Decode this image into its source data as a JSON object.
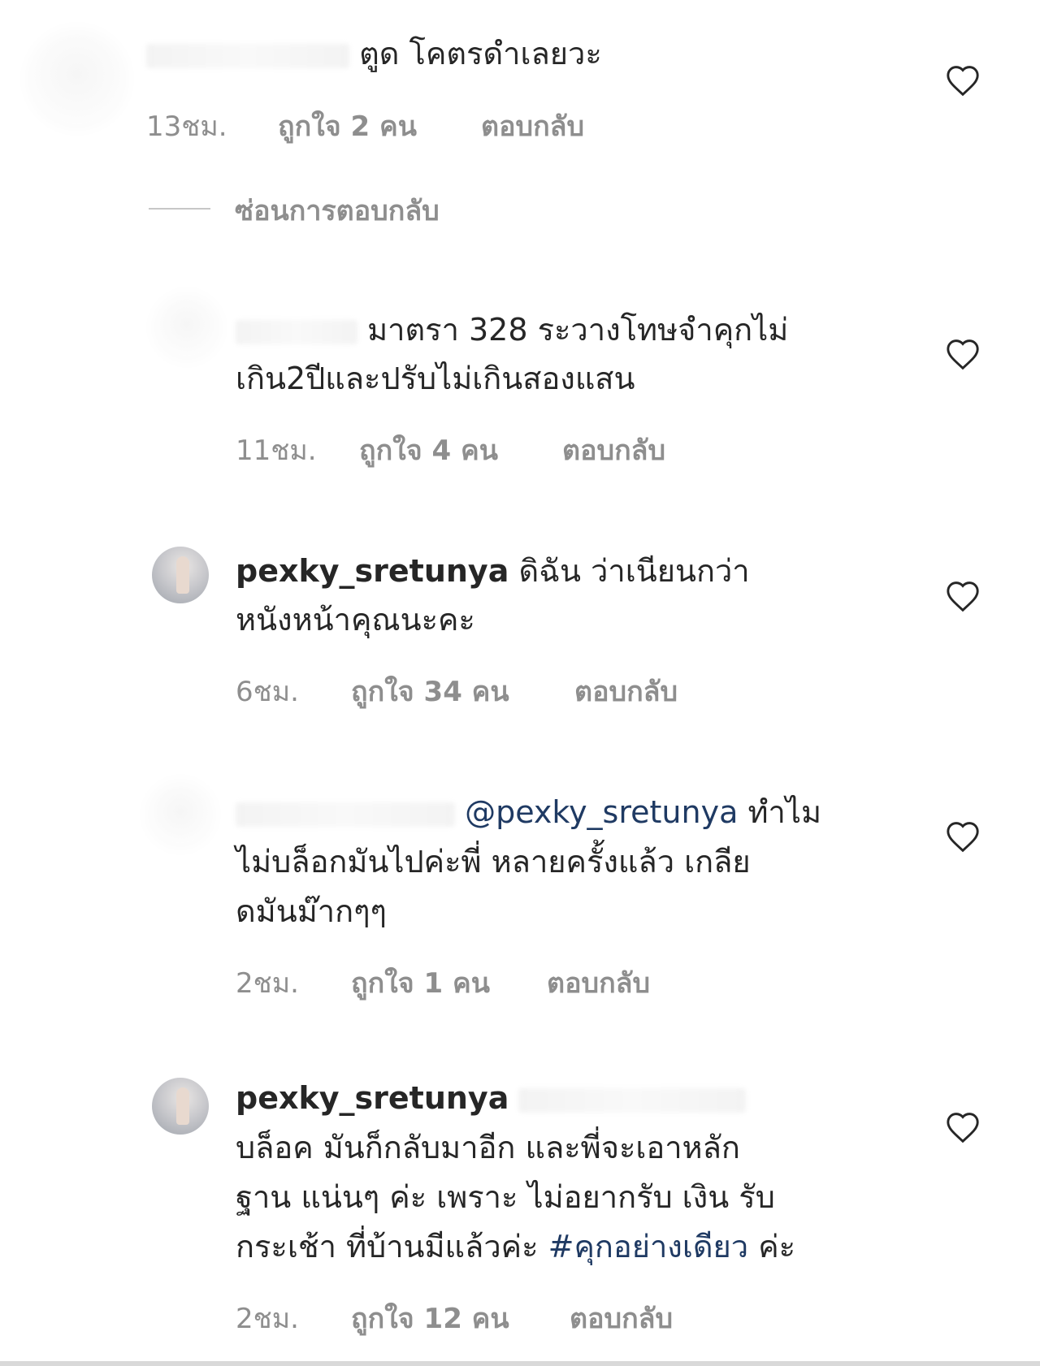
{
  "comments": [
    {
      "text": "ตูด โคตรดำเลยวะ",
      "time": "13ชม.",
      "likes": "ถูกใจ 2 คน",
      "reply": "ตอบกลับ"
    },
    {
      "text_line1": "มาตรา 328 ระวางโทษจำคุกไม่",
      "text_line2": "เกิน2ปีและปรับไม่เกินสองแสน",
      "time": "11ชม.",
      "likes": "ถูกใจ 4 คน",
      "reply": "ตอบกลับ"
    },
    {
      "username": "pexky_sretunya",
      "text_line1": "ดิฉัน ว่าเนียนกว่า",
      "text_line2": "หนังหน้าคุณนะคะ",
      "time": "6ชม.",
      "likes": "ถูกใจ 34 คน",
      "reply": "ตอบกลับ"
    },
    {
      "mention": "@pexky_sretunya",
      "text_line1": "ทำไม",
      "text_line2": "ไม่บล็อกมันไปค่ะพี่ หลายครั้งแล้ว เกลีย",
      "text_line3": "ดมันม๊ากๆๆ",
      "time": "2ชม.",
      "likes": "ถูกใจ 1 คน",
      "reply": "ตอบกลับ"
    },
    {
      "username": "pexky_sretunya",
      "text_line2": "บล็อค มันก็กลับมาอีก และพี่จะเอาหลัก",
      "text_line3": "ฐาน แน่นๆ ค่ะ  เพราะ ไม่อยากรับ เงิน รับ",
      "text_line4_prefix": "กระเช้า ที่บ้านมีแล้วค่ะ",
      "hashtag": "#คุกอย่างเดียว",
      "text_line4_suffix": "ค่ะ",
      "time": "2ชม.",
      "likes": "ถูกใจ 12 คน",
      "reply": "ตอบกลับ"
    }
  ],
  "hide_replies_label": "ซ่อนการตอบกลับ",
  "icons": {
    "like": "heart-outline-icon"
  },
  "colors": {
    "meta": "#8e8e8e",
    "text": "#262626",
    "link": "#1f3a63"
  }
}
